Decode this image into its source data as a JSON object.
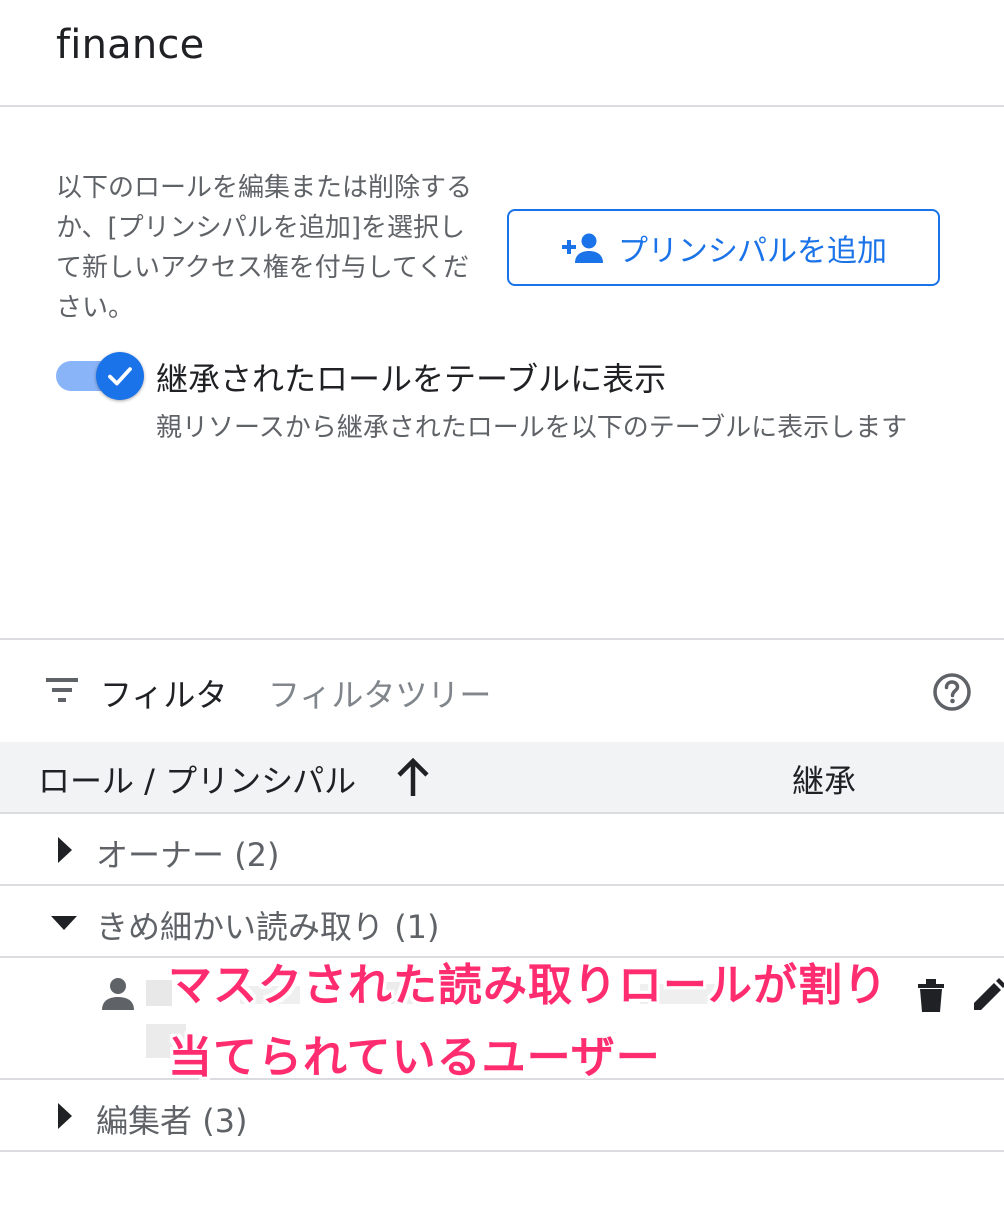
{
  "header": {
    "title": "finance"
  },
  "intro": {
    "description": "以下のロールを編集または削除するか、[プリンシパルを追加]を選択して新しいアクセス権を付与してください。",
    "add_principal_label": "プリンシパルを追加"
  },
  "toggle": {
    "checked": true,
    "label": "継承されたロールをテーブルに表示",
    "sublabel": "親リソースから継承されたロールを以下のテーブルに表示します"
  },
  "filter": {
    "label": "フィルタ",
    "placeholder": "フィルタツリー"
  },
  "table": {
    "columns": {
      "role": "ロール / プリンシパル",
      "inherit": "継承"
    },
    "rows": [
      {
        "label": "オーナー",
        "count": "(2)",
        "expanded": false
      },
      {
        "label": "きめ細かい読み取り",
        "count": "(1)",
        "expanded": true
      },
      {
        "label": "編集者",
        "count": "(3)",
        "expanded": false
      }
    ]
  },
  "annotation": {
    "line1": "マスクされた読み取りロールが割り",
    "line2": "当てられているユーザー",
    "color": "#ff2d6f"
  },
  "colors": {
    "accent": "#1a73e8",
    "toggle_track": "#8ab4f8",
    "header_bg": "#f1f3f4"
  },
  "icons": {
    "add_principal": "person-add-icon",
    "toggle": "check-icon",
    "filter": "filter-list-icon",
    "help": "help-icon",
    "sort": "arrow-up-icon",
    "collapsed": "caret-right-icon",
    "expanded": "caret-down-icon",
    "principal": "person-icon",
    "delete": "trash-icon",
    "edit": "pencil-icon"
  }
}
